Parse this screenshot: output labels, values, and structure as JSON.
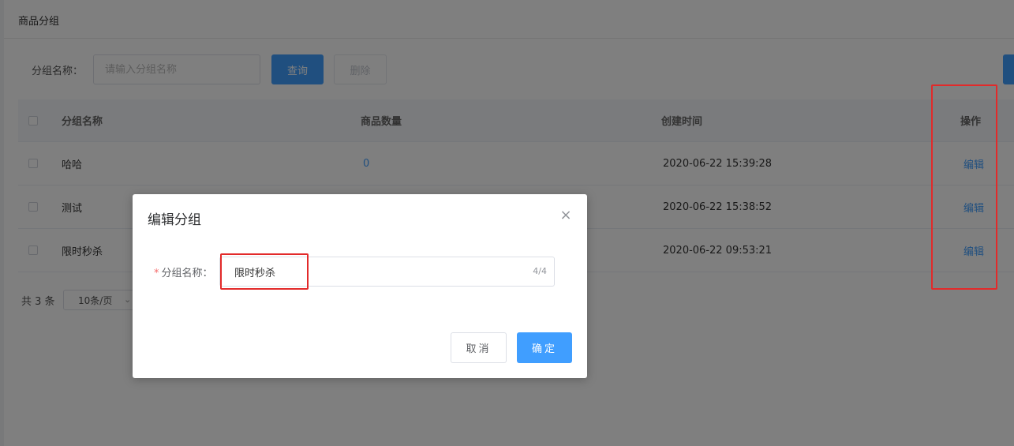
{
  "page": {
    "title": "商品分组"
  },
  "search": {
    "label": "分组名称：",
    "placeholder": "请输入分组名称",
    "query_label": "查询",
    "delete_label": "删除"
  },
  "table": {
    "columns": [
      "分组名称",
      "商品数量",
      "创建时间",
      "操作"
    ],
    "rows": [
      {
        "name": "哈哈",
        "count": "0",
        "created": "2020-06-22 15:39:28",
        "action": "编辑"
      },
      {
        "name": "测试",
        "count": "",
        "created": "2020-06-22 15:38:52",
        "action": "编辑"
      },
      {
        "name": "限时秒杀",
        "count": "",
        "created": "2020-06-22 09:53:21",
        "action": "编辑"
      }
    ]
  },
  "pagination": {
    "total": "共 3 条",
    "page_size": "10条/页"
  },
  "modal": {
    "title": "编辑分组",
    "close_icon": "close-icon",
    "field_label": "分组名称：",
    "required_mark": "*",
    "field_value": "限时秒杀",
    "char_count": "4/4",
    "cancel_label": "取消",
    "ok_label": "确定"
  },
  "colors": {
    "primary": "#409eff",
    "annotation_red": "#e22a2a",
    "required": "#f56c6c"
  }
}
